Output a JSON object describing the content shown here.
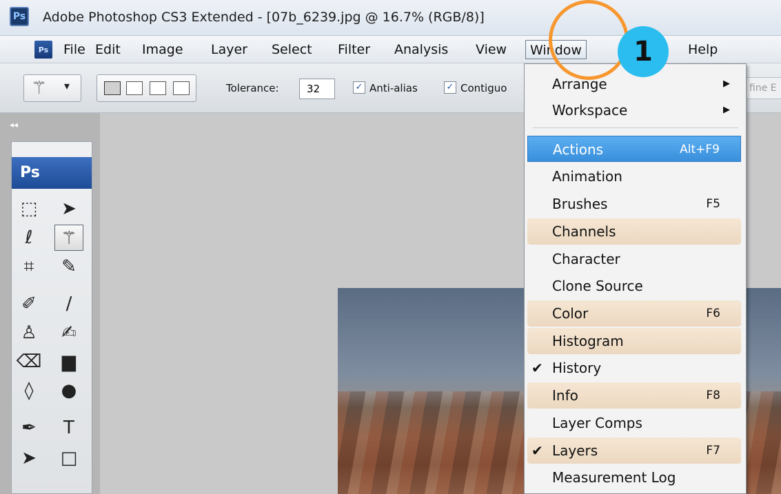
{
  "titlebar": {
    "app_badge": "Ps",
    "title": "Adobe Photoshop CS3 Extended - [07b_6239.jpg @ 16.7% (RGB/8)]"
  },
  "menubar": {
    "app_icon": "Ps",
    "items": [
      "File",
      "Edit",
      "Image",
      "Layer",
      "Select",
      "Filter",
      "Analysis",
      "View",
      "Window",
      "Help"
    ],
    "active": "Window"
  },
  "options": {
    "tool_icon": "magic-wand-icon",
    "tolerance_label": "Tolerance:",
    "tolerance_value": "32",
    "anti_alias_label": "Anti-alias",
    "anti_alias_checked": true,
    "contiguous_label": "Contiguo",
    "contiguous_checked": true,
    "refine_edge_label": "fine E"
  },
  "toolbox": {
    "header": "Ps",
    "collapse_glyph": "◂◂",
    "tools": [
      {
        "name": "marquee",
        "glyph": "⬚"
      },
      {
        "name": "move",
        "glyph": "➤"
      },
      {
        "name": "lasso",
        "glyph": "ℓ"
      },
      {
        "name": "magic-wand",
        "glyph": "⚚"
      },
      {
        "name": "crop",
        "glyph": "⌗"
      },
      {
        "name": "slice",
        "glyph": "✎"
      },
      {
        "name": "healing-brush",
        "glyph": "✐"
      },
      {
        "name": "brush",
        "glyph": "∕"
      },
      {
        "name": "clone-stamp",
        "glyph": "♙"
      },
      {
        "name": "history-brush",
        "glyph": "✍"
      },
      {
        "name": "eraser",
        "glyph": "⌫"
      },
      {
        "name": "gradient",
        "glyph": "▆"
      },
      {
        "name": "blur",
        "glyph": "◊"
      },
      {
        "name": "dodge",
        "glyph": "●"
      },
      {
        "name": "pen",
        "glyph": "✒"
      },
      {
        "name": "type",
        "glyph": "T"
      },
      {
        "name": "path-selection",
        "glyph": "➤"
      },
      {
        "name": "shape",
        "glyph": "□"
      }
    ]
  },
  "window_menu": {
    "items": [
      {
        "label": "Arrange",
        "submenu": true
      },
      {
        "label": "Workspace",
        "submenu": true
      },
      {
        "label": "Actions",
        "shortcut": "Alt+F9",
        "highlight": "blue"
      },
      {
        "label": "Animation"
      },
      {
        "label": "Brushes",
        "shortcut": "F5"
      },
      {
        "label": "Channels",
        "highlight": "tan"
      },
      {
        "label": "Character"
      },
      {
        "label": "Clone Source"
      },
      {
        "label": "Color",
        "shortcut": "F6",
        "highlight": "tan"
      },
      {
        "label": "Histogram",
        "highlight": "tan"
      },
      {
        "label": "History",
        "checked": true
      },
      {
        "label": "Info",
        "shortcut": "F8",
        "highlight": "tan"
      },
      {
        "label": "Layer Comps"
      },
      {
        "label": "Layers",
        "shortcut": "F7",
        "checked": true,
        "highlight": "tan"
      },
      {
        "label": "Measurement Log"
      }
    ]
  },
  "annotation": {
    "step_number": "1",
    "circle_color": "#f7972f",
    "badge_color": "#2bbdf0"
  },
  "colors": {
    "menu_highlight_blue": "#3a8fdc",
    "menu_highlight_tan": "#ecd8c0",
    "workspace_gray": "#c9c9c9"
  }
}
